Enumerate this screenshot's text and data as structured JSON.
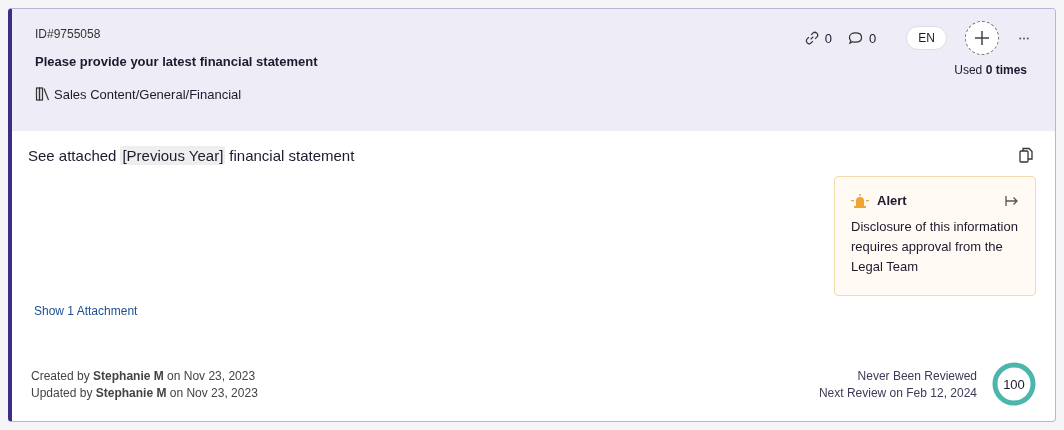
{
  "header": {
    "id": "ID#9755058",
    "title": "Please provide your latest financial statement",
    "path": "Sales Content/General/Financial",
    "links": "0",
    "comments": "0",
    "language": "EN",
    "usage": "Used **0 times**"
  },
  "answer": {
    "before": "See attached",
    "token": "[Previous Year]",
    "after": "financial statement"
  },
  "alert": {
    "title": "Alert",
    "text": "Disclosure of this information requires approval from the Legal Team"
  },
  "attachments_link": "Show 1 Attachment",
  "footer": {
    "created": "Created by **Stephanie M** on Nov 23, 2023",
    "updated": "Updated by **Stephanie M** on Nov 23, 2023",
    "review_status": "Never Been Reviewed",
    "next_review": "Next Review on Feb 12, 2024"
  },
  "score": {
    "value": "100",
    "level": 1
  }
}
